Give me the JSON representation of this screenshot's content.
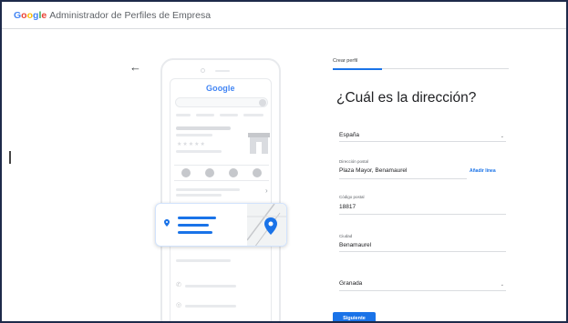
{
  "header": {
    "logo": [
      "G",
      "o",
      "o",
      "g",
      "l",
      "e"
    ],
    "title": "Administrador de Perfiles de Empresa"
  },
  "back_icon": "←",
  "illustration": {
    "google_logo": "Google",
    "stars": "★★★★★"
  },
  "form": {
    "tab_label": "Crear perfil",
    "heading": "¿Cuál es la dirección?",
    "country": {
      "value": "España"
    },
    "street": {
      "label": "Dirección postal",
      "value": "Plaza Mayor, Benamaurel",
      "add_line": "Añadir línea"
    },
    "postal_code": {
      "label": "Código postal",
      "value": "18817"
    },
    "city": {
      "label": "Ciudad",
      "value": "Benamaurel"
    },
    "province": {
      "value": "Granada"
    },
    "submit_label": "Siguiente"
  },
  "colors": {
    "accent": "#1a73e8",
    "frame_border": "#1e2a4a",
    "google_blue": "#4285f4",
    "google_red": "#ea4335",
    "google_yellow": "#fbbc05",
    "google_green": "#34a853"
  }
}
